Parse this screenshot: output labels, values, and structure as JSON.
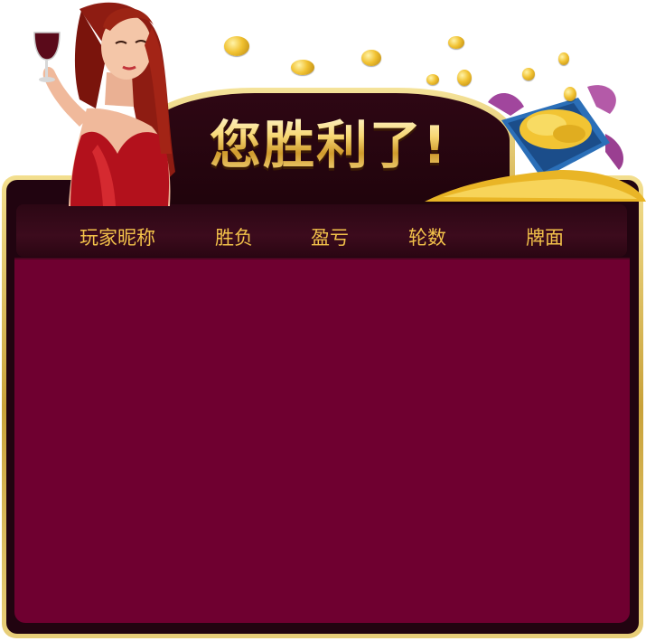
{
  "dialog": {
    "title": "您胜利了!"
  },
  "table": {
    "columns": [
      "玩家昵称",
      "胜负",
      "盈亏",
      "轮数",
      "牌面"
    ],
    "rows": []
  },
  "decorations": {
    "left_figure": "woman-with-wine-glass",
    "right_figure": "gift-box-with-gold-coins",
    "falling_items": "gold-coins"
  },
  "colors": {
    "frame_gold": "#e2c766",
    "panel_dark": "#210410",
    "header_band": "#3a0a1b",
    "content_bg": "#6f0030",
    "header_text": "#f3c24a",
    "title_gold": "#f7d774"
  }
}
